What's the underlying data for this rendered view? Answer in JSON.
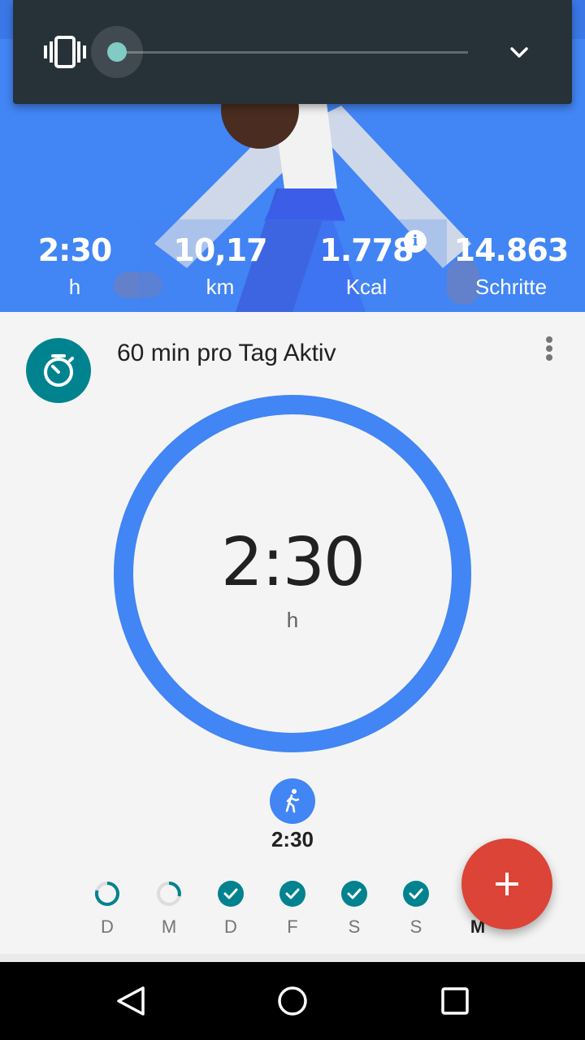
{
  "hero": {
    "stats": [
      {
        "value": "2:30",
        "unit": "h"
      },
      {
        "value": "10,17",
        "unit": "km"
      },
      {
        "value": "1.778",
        "unit": "Kcal"
      },
      {
        "value": "14.863",
        "unit": "Schritte"
      }
    ],
    "info_icon_glyph": "i"
  },
  "volume_panel": {
    "mode_icon": "vibrate-icon",
    "level": 0,
    "expand_icon": "chevron-down-icon"
  },
  "goal": {
    "icon": "timer-icon",
    "title": "60 min pro Tag Aktiv",
    "value": "2:30",
    "unit": "h",
    "progress": 1.0,
    "activity_icon": "walking-icon",
    "activity_value": "2:30"
  },
  "week": {
    "days": [
      {
        "label": "D",
        "status": "partial"
      },
      {
        "label": "M",
        "status": "partial-low"
      },
      {
        "label": "D",
        "status": "done"
      },
      {
        "label": "F",
        "status": "done"
      },
      {
        "label": "S",
        "status": "done"
      },
      {
        "label": "S",
        "status": "done"
      },
      {
        "label": "M",
        "status": "today"
      }
    ]
  },
  "fab": {
    "icon": "plus-icon"
  },
  "navbar": {
    "back": "back-icon",
    "home": "home-icon",
    "recents": "recents-icon"
  },
  "colors": {
    "primary": "#4285f4",
    "teal": "#00838f",
    "fab": "#db4437",
    "panel": "#263238"
  }
}
